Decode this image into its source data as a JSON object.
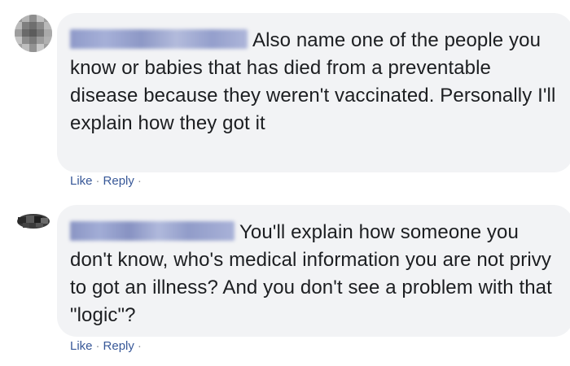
{
  "comments": [
    {
      "author_name_obscured": true,
      "text": "Also name one of the people you know or babies that has died from a preventable disease because they weren't vaccinated. Personally I'll explain how they got it",
      "like_label": "Like",
      "reply_label": "Reply",
      "separator": "·"
    },
    {
      "author_name_obscured": true,
      "text": "You'll explain how someone you don't know, who's medical information you are not privy to got an illness? And you don't see a problem with that \"logic\"?",
      "like_label": "Like",
      "reply_label": "Reply",
      "separator": "·"
    }
  ],
  "colors": {
    "bubble_background": "#f2f3f5",
    "link": "#385898",
    "text": "#1c1e21",
    "separator": "#90949c"
  }
}
